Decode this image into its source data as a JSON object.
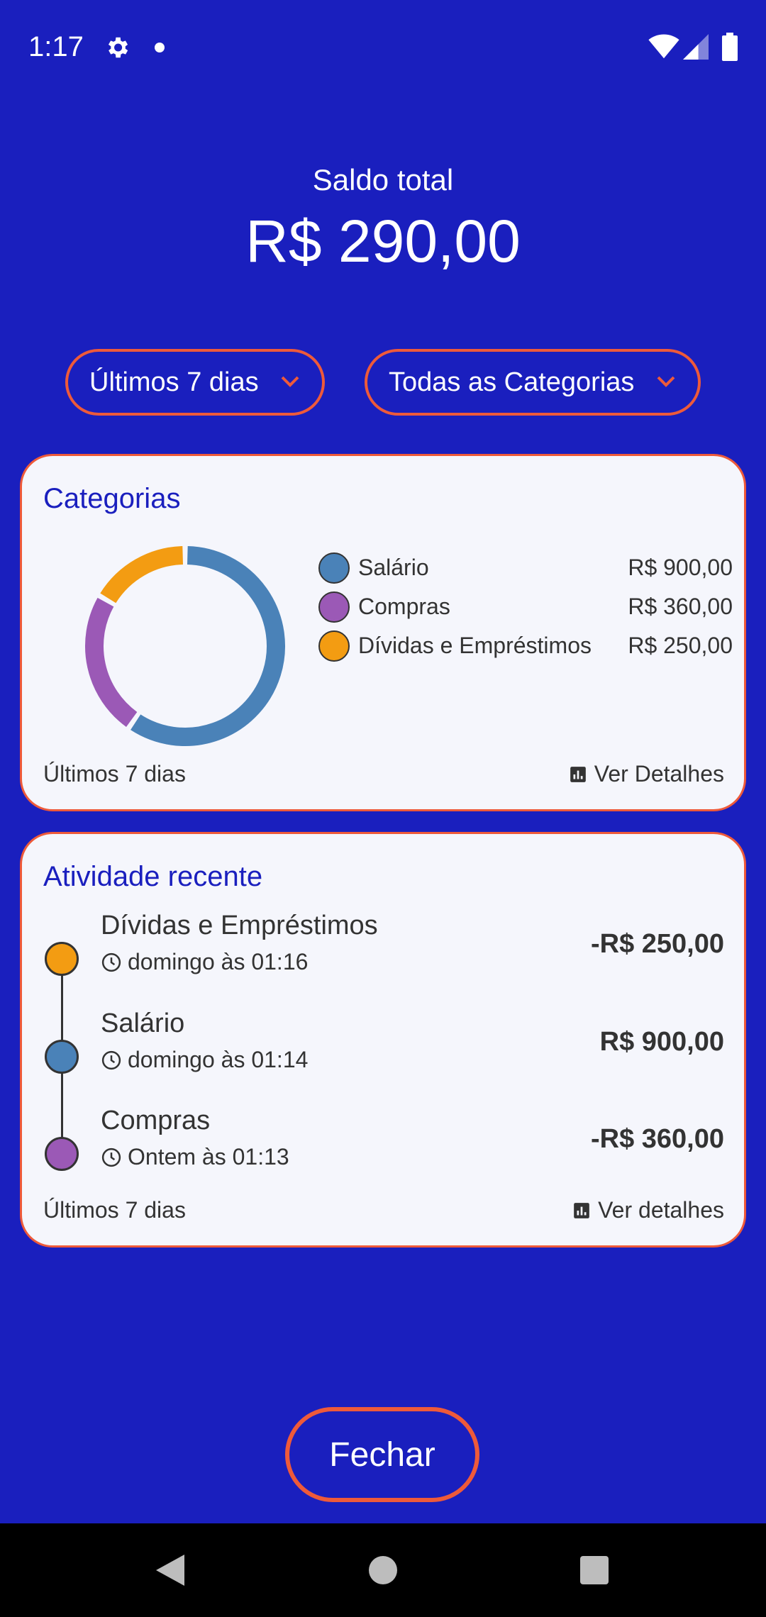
{
  "status_bar": {
    "time": "1:17",
    "icons": [
      "gear-icon",
      "notification-dot",
      "wifi-icon",
      "signal-icon",
      "battery-icon"
    ]
  },
  "header": {
    "balance_label": "Saldo total",
    "balance_value": "R$ 290,00"
  },
  "filters": {
    "period": "Últimos 7 dias",
    "category": "Todas as Categorias"
  },
  "categories_card": {
    "title": "Categorias",
    "items": [
      {
        "name": "Salário",
        "value": "R$ 900,00",
        "amount": 900,
        "color": "#4a82b8"
      },
      {
        "name": "Compras",
        "value": "R$ 360,00",
        "amount": 360,
        "color": "#9b59b6"
      },
      {
        "name": "Dívidas e Empréstimos",
        "value": "R$ 250,00",
        "amount": 250,
        "color": "#f39c12"
      }
    ],
    "footer_left": "Últimos 7 dias",
    "footer_right": "Ver Detalhes"
  },
  "activity_card": {
    "title": "Atividade recente",
    "items": [
      {
        "name": "Dívidas e Empréstimos",
        "time": "domingo às 01:16",
        "amount": "-R$ 250,00",
        "color": "#f39c12"
      },
      {
        "name": "Salário",
        "time": "domingo às 01:14",
        "amount": "R$ 900,00",
        "color": "#4a82b8"
      },
      {
        "name": "Compras",
        "time": "Ontem às 01:13",
        "amount": "-R$ 360,00",
        "color": "#9b59b6"
      }
    ],
    "footer_left": "Últimos 7 dias",
    "footer_right": "Ver detalhes"
  },
  "close_button": "Fechar",
  "colors": {
    "background": "#1a1fbe",
    "accent": "#ee5a3a",
    "card": "#f5f6fc"
  }
}
